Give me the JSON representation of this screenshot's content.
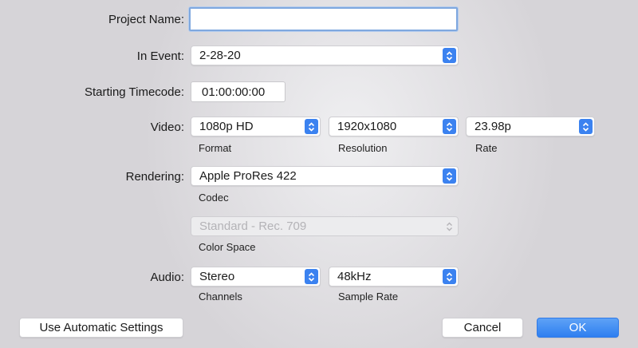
{
  "project_name": {
    "label": "Project Name:",
    "value": ""
  },
  "in_event": {
    "label": "In Event:",
    "value": "2-28-20"
  },
  "starting_timecode": {
    "label": "Starting Timecode:",
    "value": "01:00:00:00"
  },
  "video": {
    "label": "Video:",
    "format": {
      "value": "1080p HD",
      "caption": "Format"
    },
    "resolution": {
      "value": "1920x1080",
      "caption": "Resolution"
    },
    "rate": {
      "value": "23.98p",
      "caption": "Rate"
    }
  },
  "rendering": {
    "label": "Rendering:",
    "codec": {
      "value": "Apple ProRes 422",
      "caption": "Codec"
    },
    "color_space": {
      "value": "Standard - Rec. 709",
      "caption": "Color Space",
      "disabled": true
    }
  },
  "audio": {
    "label": "Audio:",
    "channels": {
      "value": "Stereo",
      "caption": "Channels"
    },
    "sample_rate": {
      "value": "48kHz",
      "caption": "Sample Rate"
    }
  },
  "buttons": {
    "automatic": "Use Automatic Settings",
    "cancel": "Cancel",
    "ok": "OK"
  },
  "colors": {
    "accent": "#3b82f0",
    "focus_ring": "#7fa8df"
  },
  "icons": {
    "popup_arrows": "chevron-up-down-icon"
  }
}
